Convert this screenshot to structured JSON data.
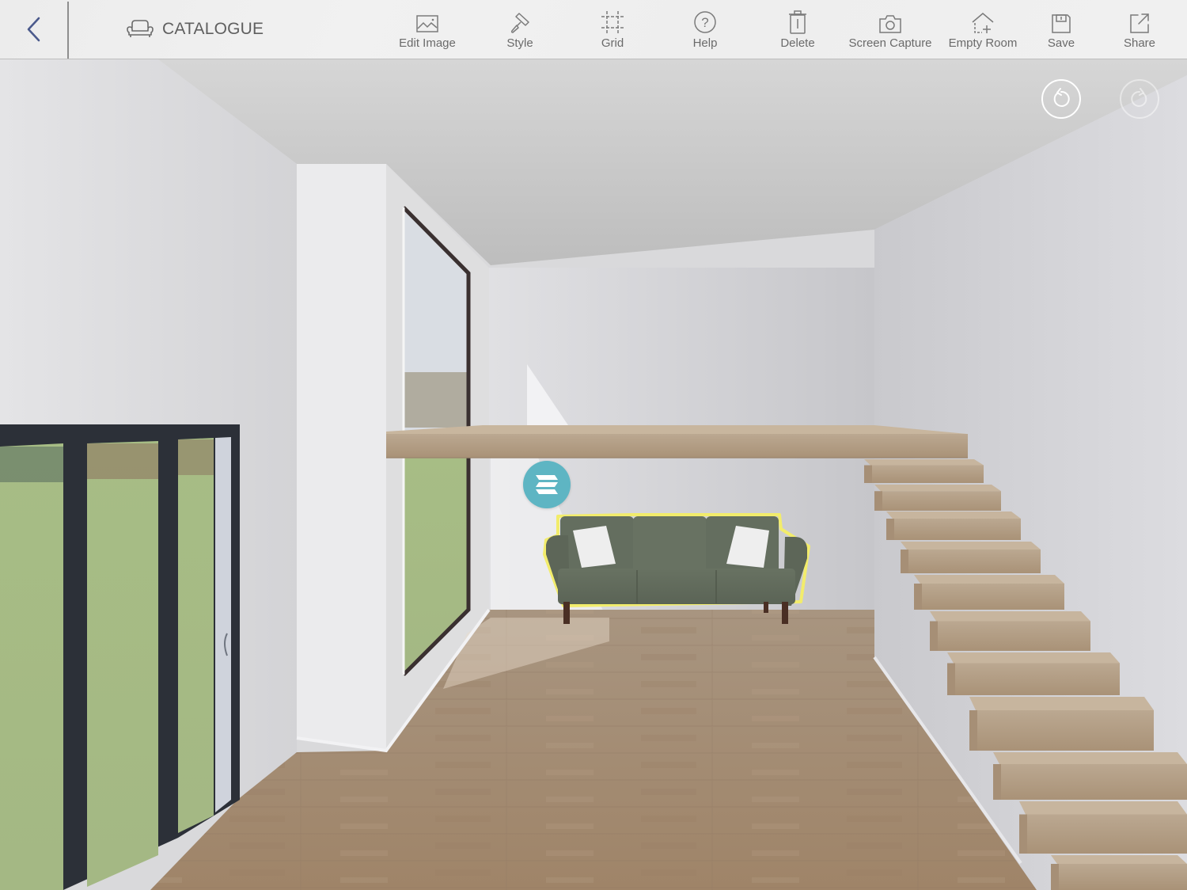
{
  "toolbar": {
    "back_icon": "chevron-left-icon",
    "catalogue": {
      "label": "CATALOGUE",
      "icon": "sofa-icon"
    },
    "tools": [
      {
        "id": "edit-image",
        "label": "Edit Image",
        "icon": "image-icon"
      },
      {
        "id": "style",
        "label": "Style",
        "icon": "paint-roller-icon"
      },
      {
        "id": "grid",
        "label": "Grid",
        "icon": "grid-crop-icon"
      },
      {
        "id": "help",
        "label": "Help",
        "icon": "question-circle-icon"
      },
      {
        "id": "delete",
        "label": "Delete",
        "icon": "trash-icon"
      },
      {
        "id": "screen-capture",
        "label": "Screen Capture",
        "icon": "camera-icon"
      },
      {
        "id": "empty-room",
        "label": "Empty Room",
        "icon": "house-plus-icon"
      },
      {
        "id": "save",
        "label": "Save",
        "icon": "floppy-disk-icon"
      },
      {
        "id": "share",
        "label": "Share",
        "icon": "share-out-icon"
      }
    ]
  },
  "canvas": {
    "undo": {
      "icon": "undo-icon",
      "enabled": true
    },
    "redo": {
      "icon": "redo-icon",
      "enabled": false
    },
    "selected_product": {
      "name": "Green 3-seat sofa",
      "badge_icon": "brand-logo-icon",
      "highlight_color": "#f2ec6b"
    },
    "scene_objects": [
      "sliding-glass-door",
      "tall-window",
      "mezzanine-loft",
      "floating-staircase",
      "oak-floor",
      "sofa"
    ]
  },
  "colors": {
    "toolbar_bg": "#efefef",
    "toolbar_text": "#6a6a6a",
    "back_chevron": "#4b5a8c",
    "badge": "#5eb5c3",
    "sofa": "#626c5c",
    "wood": "#b59f86",
    "floor": "#a58c72",
    "window_frame": "#2c3038"
  }
}
